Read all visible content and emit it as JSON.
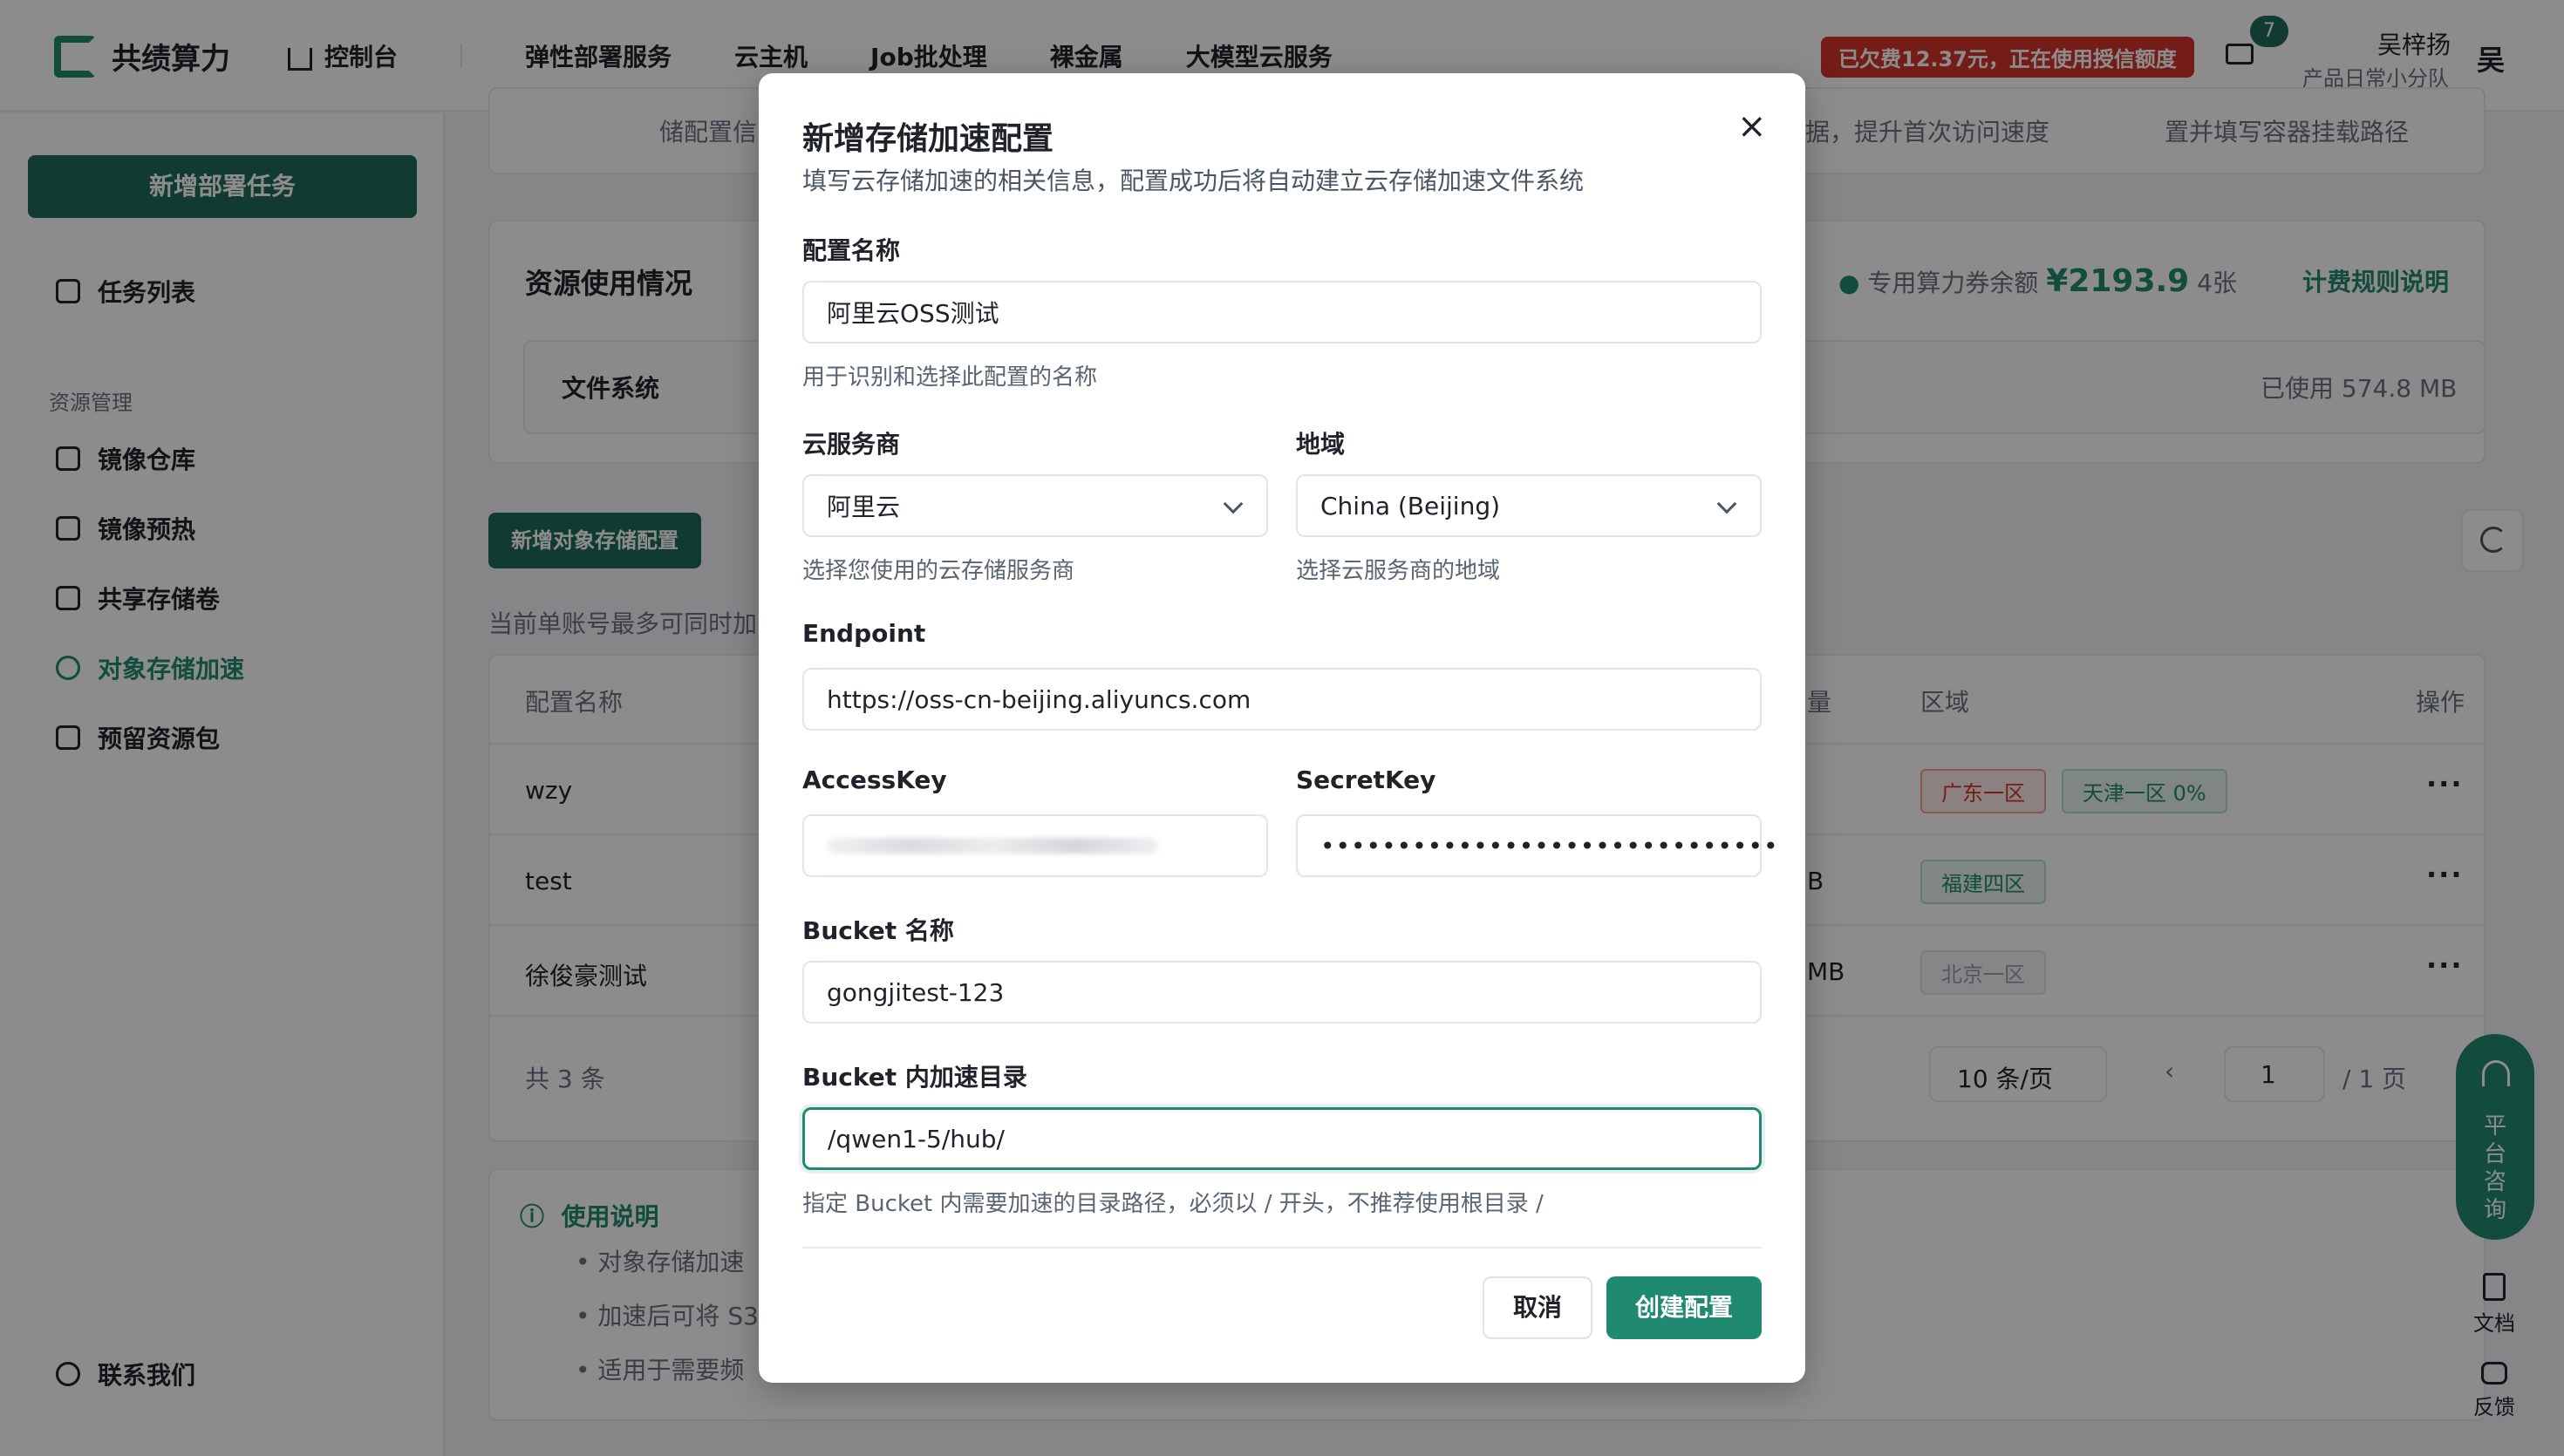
{
  "header": {
    "brand": "共绩算力",
    "nav": [
      "控制台",
      "弹性部署服务",
      "云主机",
      "Job批处理",
      "裸金属",
      "大模型云服务"
    ],
    "debt_banner": "已欠费12.37元，正在使用授信额度",
    "mail_badge": "7",
    "user_name": "吴梓扬",
    "user_team": "产品日常小分队",
    "avatar": "吴"
  },
  "sidebar": {
    "add_task": "新增部署任务",
    "task_list": "任务列表",
    "section": "资源管理",
    "items": [
      "镜像仓库",
      "镜像预热",
      "共享存储卷",
      "对象存储加速",
      "预留资源包"
    ],
    "contact": "联系我们"
  },
  "main": {
    "top_step_left": "储配置信",
    "top_step_mid": "据，提升首次访问速度",
    "top_step_right": "置并填写容器挂载路径",
    "usage_title": "资源使用情况",
    "voucher_label": "专用算力券余额",
    "voucher_amount": "¥2193.9",
    "voucher_count": "4张",
    "billing_link": "计费规则说明",
    "fs_label": "文件系统",
    "fs_used": "已使用 574.8 MB",
    "add_config_btn": "新增对象存储配置",
    "limit_note": "当前单账号最多可同时加",
    "col_name": "配置名称",
    "col_capacity": "量",
    "col_region": "区域",
    "col_action": "操作",
    "rows": [
      {
        "name": "wzy",
        "tags": [
          "广东一区",
          "天津一区 0%"
        ]
      },
      {
        "name": "test",
        "cap": "B",
        "tags": [
          "福建四区"
        ]
      },
      {
        "name": "徐俊豪测试",
        "cap": "MB",
        "tags": [
          "北京一区"
        ]
      }
    ],
    "total": "共 3 条",
    "page_size": "10 条/页",
    "page_num": "1",
    "page_total": "/ 1 页",
    "info_title": "使用说明",
    "info_1": "对象存储加速",
    "info_2": "加速后可将 S3",
    "info_3": "适用于需要频",
    "float_label": "平台咨询",
    "docs": "文档",
    "feedback": "反馈"
  },
  "modal": {
    "title": "新增存储加速配置",
    "subtitle": "填写云存储加速的相关信息，配置成功后将自动建立云存储加速文件系统",
    "name_label": "配置名称",
    "name_value": "阿里云OSS测试",
    "name_hint": "用于识别和选择此配置的名称",
    "provider_label": "云服务商",
    "provider_value": "阿里云",
    "provider_hint": "选择您使用的云存储服务商",
    "region_label": "地域",
    "region_value": "China (Beijing)",
    "region_hint": "选择云服务商的地域",
    "endpoint_label": "Endpoint",
    "endpoint_value": "https://oss-cn-beijing.aliyuncs.com",
    "accesskey_label": "AccessKey",
    "secretkey_label": "SecretKey",
    "secretkey_value": "••••••••••••••••••••••••••••••",
    "bucket_label": "Bucket 名称",
    "bucket_value": "gongjitest-123",
    "dir_label": "Bucket 内加速目录",
    "dir_value": "/qwen1-5/hub/",
    "dir_hint": "指定 Bucket 内需要加速的目录路径，必须以 / 开头，不推荐使用根目录 /",
    "cancel": "取消",
    "create": "创建配置"
  }
}
